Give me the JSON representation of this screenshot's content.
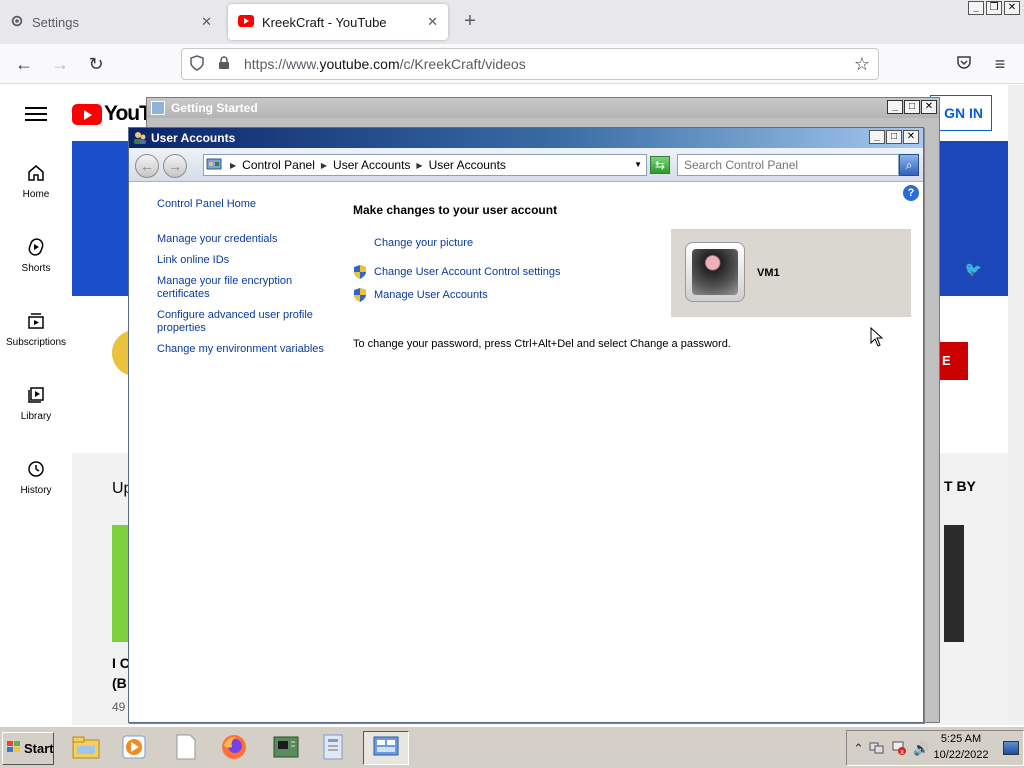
{
  "browser": {
    "tabs": [
      {
        "label": "Settings",
        "active": false
      },
      {
        "label": "KreekCraft - YouTube",
        "active": true
      }
    ],
    "url_prefix": "https://www.",
    "url_domain": "youtube.com",
    "url_path": "/c/KreekCraft/videos"
  },
  "youtube": {
    "logo_text": "YouTu",
    "signin_text": "GN IN",
    "sidebar": [
      {
        "label": "Home",
        "icon": "home-icon"
      },
      {
        "label": "Shorts",
        "icon": "shorts-icon"
      },
      {
        "label": "Subscriptions",
        "icon": "subscriptions-icon"
      },
      {
        "label": "Library",
        "icon": "library-icon"
      },
      {
        "label": "History",
        "icon": "history-icon"
      }
    ],
    "subscribe_fragment": "E",
    "section_fragment": "Up",
    "sort_fragment": "T BY",
    "video_title_line1": "I C",
    "video_title_line2": "(B",
    "video_views_fragment": "49"
  },
  "getting_started": {
    "title": "Getting Started"
  },
  "user_accounts": {
    "title": "User Accounts",
    "breadcrumb": [
      "Control Panel",
      "User Accounts",
      "User Accounts"
    ],
    "search_placeholder": "Search Control Panel",
    "left_links": {
      "home": "Control Panel Home",
      "items": [
        "Manage your credentials",
        "Link online IDs",
        "Manage your file encryption certificates",
        "Configure advanced user profile properties",
        "Change my environment variables"
      ]
    },
    "heading": "Make changes to your user account",
    "tasks": [
      {
        "label": "Change your picture",
        "icon": "none"
      },
      {
        "label": "Change User Account Control settings",
        "icon": "uac-shield-icon"
      },
      {
        "label": "Manage User Accounts",
        "icon": "uac-shield-icon"
      }
    ],
    "password_note": "To change your password, press Ctrl+Alt+Del and select Change a password.",
    "username": "VM1"
  },
  "taskbar": {
    "start_label": "Start",
    "apps": [
      "explorer-icon",
      "media-player-icon",
      "notepad-icon",
      "firefox-icon",
      "hardware-icon",
      "document-icon",
      "control-panel-icon"
    ],
    "time": "5:25 AM",
    "date": "10/22/2022"
  },
  "colors": {
    "yt_red": "#ff0000",
    "yt_banner": "#1a4fc9",
    "link_blue": "#0b3a9f",
    "title_bar": "#0a246a",
    "taskbar": "#d4d0c8"
  }
}
